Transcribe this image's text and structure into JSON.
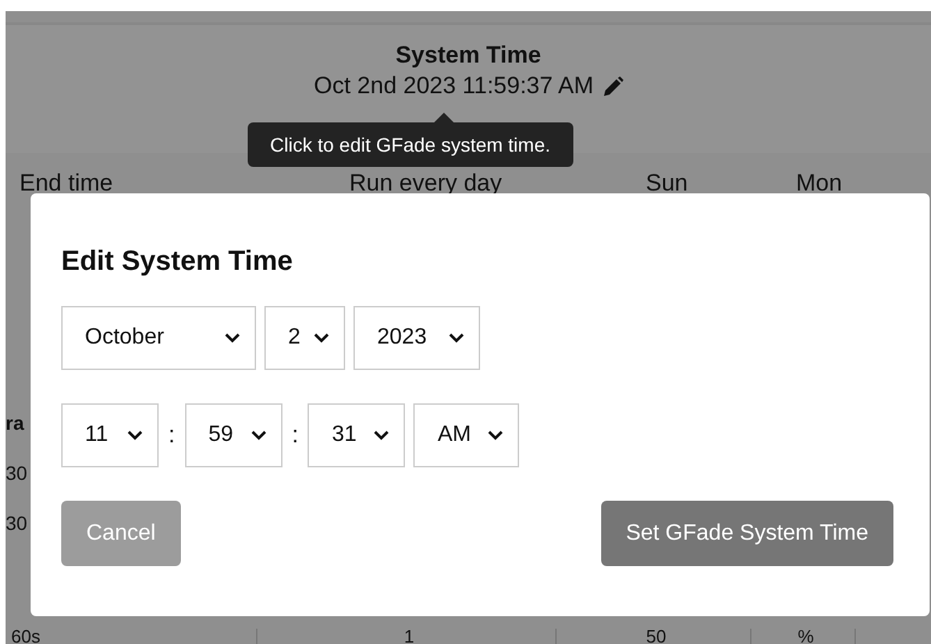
{
  "header": {
    "title": "System Time",
    "datetime": "Oct 2nd 2023 11:59:37 AM",
    "tooltip": "Click to edit GFade system time."
  },
  "table": {
    "columns": [
      "End time",
      "Run every day",
      "Sun",
      "Mon"
    ],
    "row_fragments": [
      {
        "text": "ra",
        "kind": "heading"
      },
      {
        "text": "30",
        "kind": "cell"
      },
      {
        "text": "30",
        "kind": "cell"
      }
    ],
    "bottom_row": [
      "60s",
      "1",
      "50",
      "%"
    ]
  },
  "dialog": {
    "title": "Edit System Time",
    "date_fields": [
      {
        "value": "October"
      },
      {
        "value": "2"
      },
      {
        "value": "2023"
      }
    ],
    "time_fields": [
      {
        "value": "11"
      },
      {
        "value": "59",
        "separator": ":"
      },
      {
        "value": "31",
        "separator": ":"
      },
      {
        "value": "AM"
      }
    ],
    "buttons": [
      {
        "label": "Cancel",
        "kind": "secondary"
      },
      {
        "label": "Set GFade System Time",
        "kind": "primary"
      }
    ]
  }
}
